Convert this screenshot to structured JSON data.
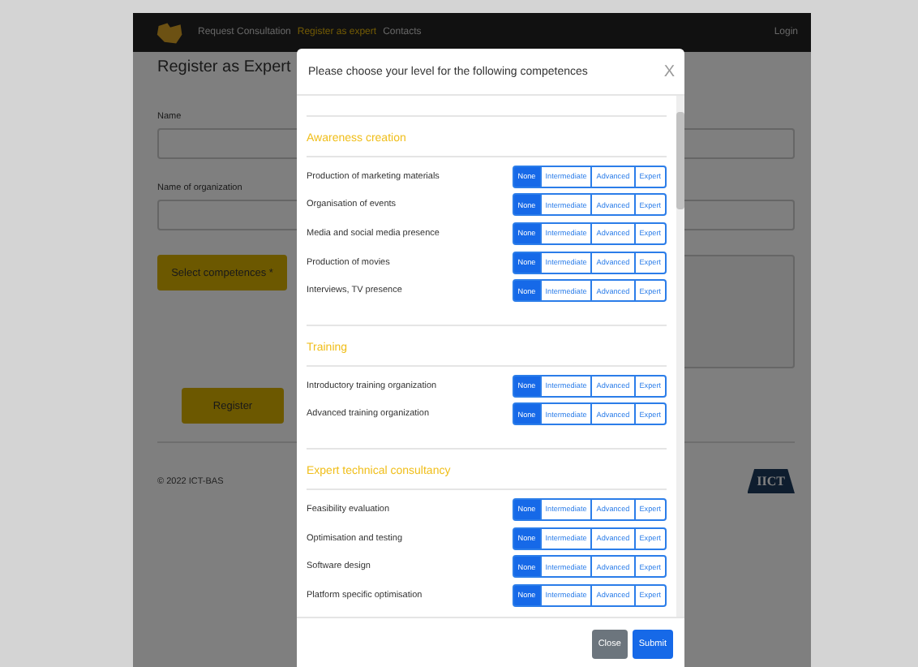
{
  "nav": {
    "items": [
      {
        "label": "Request Consultation",
        "selected": false
      },
      {
        "label": "Register as expert",
        "selected": true
      },
      {
        "label": "Contacts",
        "selected": false
      }
    ],
    "login": "Login"
  },
  "page": {
    "title": "Register as Expert",
    "fields": [
      {
        "label": "Name"
      },
      {
        "label": "Name of organization"
      }
    ],
    "select_button": "Select competences *",
    "register_button": "Register",
    "footer": "© 2022 ICT-BAS",
    "logo_text": "IICT"
  },
  "modal": {
    "title": "Please choose your level for the following competences",
    "close": "X",
    "sections": [
      {
        "title": "Awareness creation",
        "rows": [
          {
            "name": "Production of marketing materials",
            "options": [
              {
                "label": "None",
                "selected": true
              },
              {
                "label": "Intermediate",
                "selected": false
              },
              {
                "label": "Advanced",
                "selected": false
              },
              {
                "label": "Expert",
                "selected": false
              }
            ]
          },
          {
            "name": "Organisation of events",
            "options": [
              {
                "label": "None",
                "selected": true
              },
              {
                "label": "Intermediate",
                "selected": false
              },
              {
                "label": "Advanced",
                "selected": false
              },
              {
                "label": "Expert",
                "selected": false
              }
            ]
          },
          {
            "name": "Media and social media presence",
            "options": [
              {
                "label": "None",
                "selected": true
              },
              {
                "label": "Intermediate",
                "selected": false
              },
              {
                "label": "Advanced",
                "selected": false
              },
              {
                "label": "Expert",
                "selected": false
              }
            ]
          },
          {
            "name": "Production of movies",
            "options": [
              {
                "label": "None",
                "selected": true
              },
              {
                "label": "Intermediate",
                "selected": false
              },
              {
                "label": "Advanced",
                "selected": false
              },
              {
                "label": "Expert",
                "selected": false
              }
            ]
          },
          {
            "name": "Interviews, TV presence",
            "options": [
              {
                "label": "None",
                "selected": true
              },
              {
                "label": "Intermediate",
                "selected": false
              },
              {
                "label": "Advanced",
                "selected": false
              },
              {
                "label": "Expert",
                "selected": false
              }
            ]
          }
        ]
      },
      {
        "title": "Training",
        "rows": [
          {
            "name": "Introductory training organization",
            "options": [
              {
                "label": "None",
                "selected": true
              },
              {
                "label": "Intermediate",
                "selected": false
              },
              {
                "label": "Advanced",
                "selected": false
              },
              {
                "label": "Expert",
                "selected": false
              }
            ]
          },
          {
            "name": "Advanced training organization",
            "options": [
              {
                "label": "None",
                "selected": true
              },
              {
                "label": "Intermediate",
                "selected": false
              },
              {
                "label": "Advanced",
                "selected": false
              },
              {
                "label": "Expert",
                "selected": false
              }
            ]
          }
        ]
      },
      {
        "title": "Expert technical consultancy",
        "rows": [
          {
            "name": "Feasibility evaluation",
            "options": [
              {
                "label": "None",
                "selected": true
              },
              {
                "label": "Intermediate",
                "selected": false
              },
              {
                "label": "Advanced",
                "selected": false
              },
              {
                "label": "Expert",
                "selected": false
              }
            ]
          },
          {
            "name": "Optimisation and testing",
            "options": [
              {
                "label": "None",
                "selected": true
              },
              {
                "label": "Intermediate",
                "selected": false
              },
              {
                "label": "Advanced",
                "selected": false
              },
              {
                "label": "Expert",
                "selected": false
              }
            ]
          },
          {
            "name": "Software design",
            "options": [
              {
                "label": "None",
                "selected": true
              },
              {
                "label": "Intermediate",
                "selected": false
              },
              {
                "label": "Advanced",
                "selected": false
              },
              {
                "label": "Expert",
                "selected": false
              }
            ]
          },
          {
            "name": "Platform specific optimisation",
            "options": [
              {
                "label": "None",
                "selected": true
              },
              {
                "label": "Intermediate",
                "selected": false
              },
              {
                "label": "Advanced",
                "selected": false
              },
              {
                "label": "Expert",
                "selected": false
              }
            ]
          }
        ]
      }
    ],
    "buttons": {
      "close": "Close",
      "submit": "Submit"
    }
  }
}
